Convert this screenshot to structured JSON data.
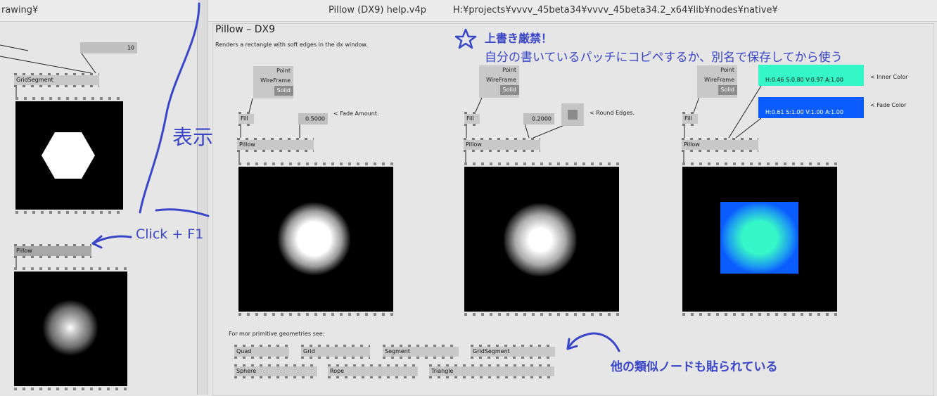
{
  "titlebar": {
    "filename": "Pillow (DX9) help.v4p",
    "path": "H:¥projects¥vvvv_45beta34¥vvvv_45beta34.2_x64¥lib¥nodes¥native¥"
  },
  "left_window": {
    "title_fragment": "rawing¥",
    "iobox_value": "10",
    "gridsegment_node": "GridSegment",
    "pillow_node": "Pillow"
  },
  "annotations": {
    "hyouji": "表示",
    "click_f1": "Click + F1",
    "warning_title": "上書き厳禁！",
    "warning_body": "自分の書いているパッチにコピペするか、別名で保存してから使う",
    "similar_nodes": "他の類似ノードも貼られている"
  },
  "help": {
    "heading": "Pillow – DX9",
    "description": "Renders a rectangle with soft edges in the dx window.",
    "enum_options": [
      "Point",
      "WireFrame",
      "Solid"
    ],
    "fill_node": "Fill",
    "pillow_node": "Pillow",
    "example1": {
      "value": "0.5000",
      "comment": "< Fade Amount."
    },
    "example2": {
      "value": "0.2000",
      "comment": "< Round Edges."
    },
    "example3": {
      "inner_color_value": "H:0.46  S:0.80  V:0.97  A:1.00",
      "inner_color_label": "< Inner Color",
      "inner_color_hex": "#35f7c8",
      "fade_color_value": "H:0.61  S:1.00  V:1.00  A:1.00",
      "fade_color_label": "< Fade Color",
      "fade_color_hex": "#0a5cff"
    },
    "see_also_label": "For mor primitive geometries see:",
    "see_also_row1": [
      "Quad",
      "Grid",
      "Segment",
      "GridSegment"
    ],
    "see_also_row2": [
      "Sphere",
      "Rope",
      "Triangle"
    ]
  },
  "colors": {
    "annotation_blue": "#3a46c8",
    "node_gray": "#c8c8c8",
    "renderer_bg": "#000000"
  }
}
